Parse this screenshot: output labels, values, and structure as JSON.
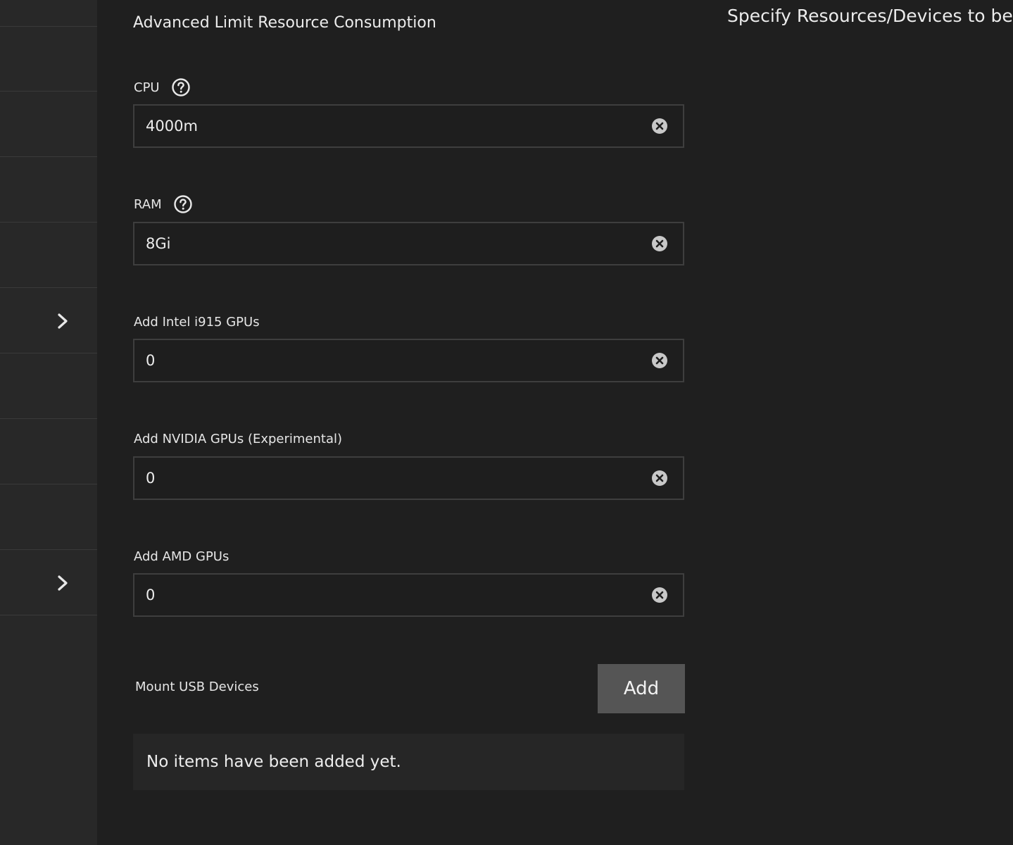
{
  "header": {
    "section_title": "Advanced Limit Resource Consumption",
    "side_heading": "Specify Resources/Devices to be A"
  },
  "fields": [
    {
      "label": "CPU",
      "value": "4000m",
      "has_help": true
    },
    {
      "label": "RAM",
      "value": "8Gi",
      "has_help": true
    },
    {
      "label": "Add Intel i915 GPUs",
      "value": "0",
      "has_help": false
    },
    {
      "label": "Add NVIDIA GPUs (Experimental)",
      "value": "0",
      "has_help": false
    },
    {
      "label": "Add AMD GPUs",
      "value": "0",
      "has_help": false
    }
  ],
  "usb": {
    "label": "Mount USB Devices",
    "add_label": "Add",
    "empty_text": "No items have been added yet."
  },
  "icons": {
    "help": "help-circle-icon",
    "clear": "clear-circle-icon",
    "chevron": "chevron-right-icon"
  },
  "colors": {
    "background": "#1f1f1f",
    "sidebar": "#282828",
    "button": "#555555"
  }
}
